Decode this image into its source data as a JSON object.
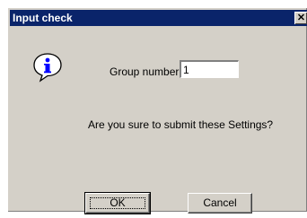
{
  "window": {
    "title": "Input check",
    "close_glyph": "✕"
  },
  "form": {
    "group_label": "Group number",
    "group_value": "1"
  },
  "message": "Are you sure to submit these Settings?",
  "buttons": {
    "ok": "OK",
    "cancel": "Cancel"
  },
  "icon": {
    "name": "info-icon",
    "glyph": "i"
  },
  "colors": {
    "titlebar": "#0a246a",
    "window_bg": "#d4d0c8",
    "info_blue": "#0000ff"
  }
}
